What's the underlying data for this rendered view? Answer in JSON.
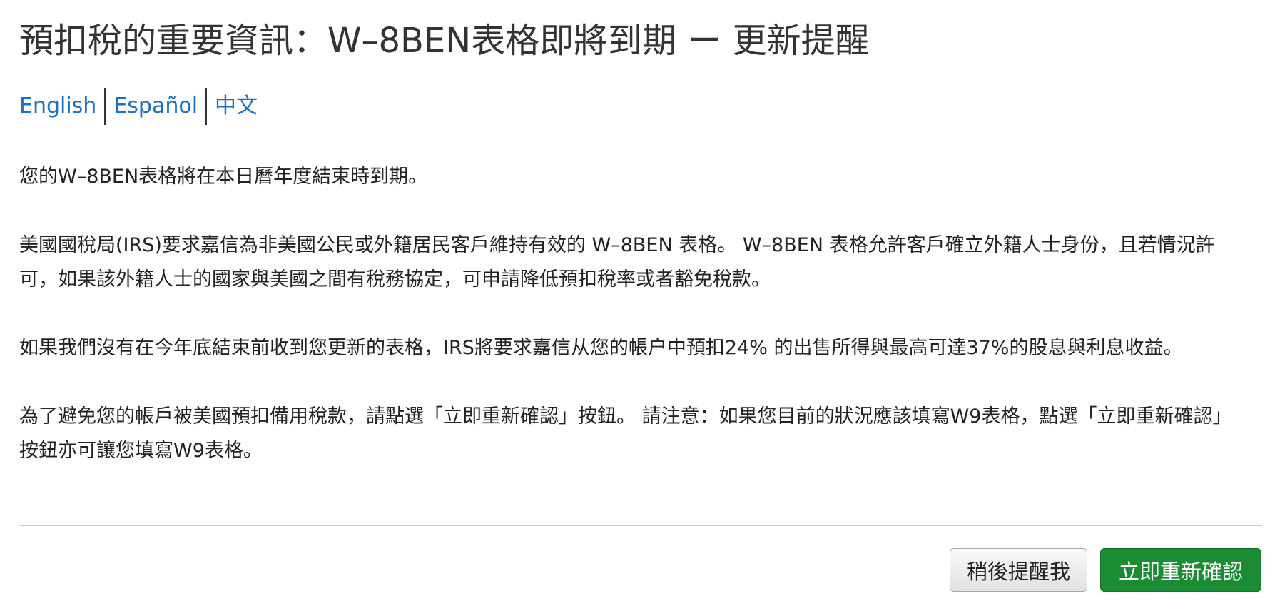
{
  "title": "預扣稅的重要資訊：W–8BEN表格即將到期 ー 更新提醒",
  "languages": [
    {
      "label": "English"
    },
    {
      "label": "Español"
    },
    {
      "label": "中文"
    }
  ],
  "paragraphs": [
    "您的W–8BEN表格將在本日曆年度結束時到期。",
    "美國國稅局(IRS)要求嘉信為非美國公民或外籍居民客戶維持有效的 W–8BEN 表格。 W–8BEN 表格允許客戶確立外籍人士身份，且若情況許可，如果該外籍人士的國家與美國之間有稅務協定，可申請降低預扣稅率或者豁免稅款。",
    "如果我們沒有在今年底結束前收到您更新的表格，IRS將要求嘉信从您的帳户中預扣24% 的出售所得與最高可達37%的股息與利息收益。",
    "為了避免您的帳戶被美國預扣備用稅款，請點選「立即重新確認」按鈕。 請注意：如果您目前的狀況應該填寫W9表格，點選「立即重新確認」按鈕亦可讓您填寫W9表格。"
  ],
  "buttons": {
    "remind_later": "稍後提醒我",
    "recertify_now": "立即重新確認"
  },
  "colors": {
    "link": "#1a6fc9",
    "primary_button": "#1c8c34",
    "secondary_button": "#e8e8e8",
    "divider": "#cccccc"
  }
}
